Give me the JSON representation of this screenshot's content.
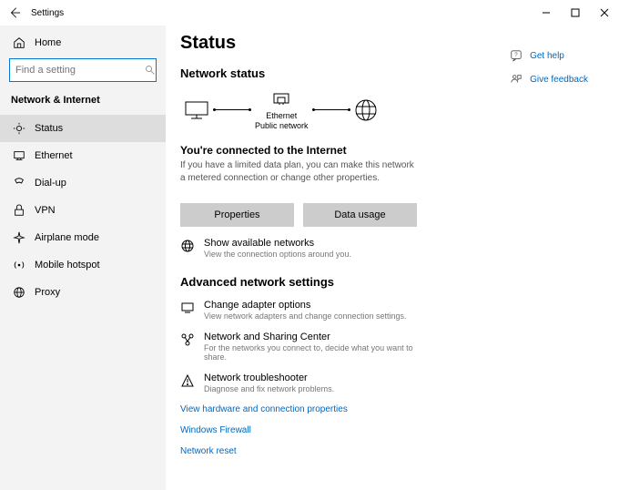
{
  "window": {
    "title": "Settings"
  },
  "sidebar": {
    "home": "Home",
    "search_placeholder": "Find a setting",
    "section": "Network & Internet",
    "items": [
      {
        "label": "Status"
      },
      {
        "label": "Ethernet"
      },
      {
        "label": "Dial-up"
      },
      {
        "label": "VPN"
      },
      {
        "label": "Airplane mode"
      },
      {
        "label": "Mobile hotspot"
      },
      {
        "label": "Proxy"
      }
    ]
  },
  "main": {
    "title": "Status",
    "section1": "Network status",
    "diagram": {
      "device": "Ethernet",
      "type": "Public network"
    },
    "headline": "You're connected to the Internet",
    "sub": "If you have a limited data plan, you can make this network a metered connection or change other properties.",
    "btn_properties": "Properties",
    "btn_data_usage": "Data usage",
    "show_networks": {
      "t": "Show available networks",
      "d": "View the connection options around you."
    },
    "section2": "Advanced network settings",
    "adapter": {
      "t": "Change adapter options",
      "d": "View network adapters and change connection settings."
    },
    "sharing": {
      "t": "Network and Sharing Center",
      "d": "For the networks you connect to, decide what you want to share."
    },
    "trouble": {
      "t": "Network troubleshooter",
      "d": "Diagnose and fix network problems."
    },
    "link1": "View hardware and connection properties",
    "link2": "Windows Firewall",
    "link3": "Network reset"
  },
  "right": {
    "help": "Get help",
    "feedback": "Give feedback"
  }
}
